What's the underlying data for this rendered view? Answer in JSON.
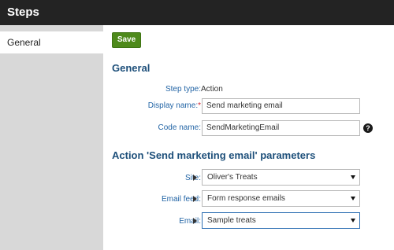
{
  "window": {
    "title": "Steps"
  },
  "sidebar": {
    "items": [
      {
        "label": "General"
      }
    ]
  },
  "toolbar": {
    "save_label": "Save"
  },
  "general": {
    "heading": "General",
    "step_type": {
      "label": "Step type:",
      "value": "Action"
    },
    "display_name": {
      "label": "Display name:",
      "required_mark": "*",
      "value": "Send marketing email"
    },
    "code_name": {
      "label": "Code name:",
      "value": "SendMarketingEmail"
    }
  },
  "params": {
    "heading": "Action 'Send marketing email' parameters",
    "site": {
      "label": "Site:",
      "value": "Oliver's Treats"
    },
    "email_feed": {
      "label": "Email feed:",
      "value": "Form response emails"
    },
    "email": {
      "label": "Email:",
      "value": "Sample treats"
    }
  },
  "icons": {
    "help": "question-circle-icon",
    "expand": "triangle-right-icon",
    "dropdown": "caret-down-icon"
  },
  "colors": {
    "accent": "#1d4f7a",
    "label": "#2264a5",
    "save_button": "#4e8a1b",
    "titlebar": "#232323",
    "sidebar": "#d8d8d8"
  }
}
